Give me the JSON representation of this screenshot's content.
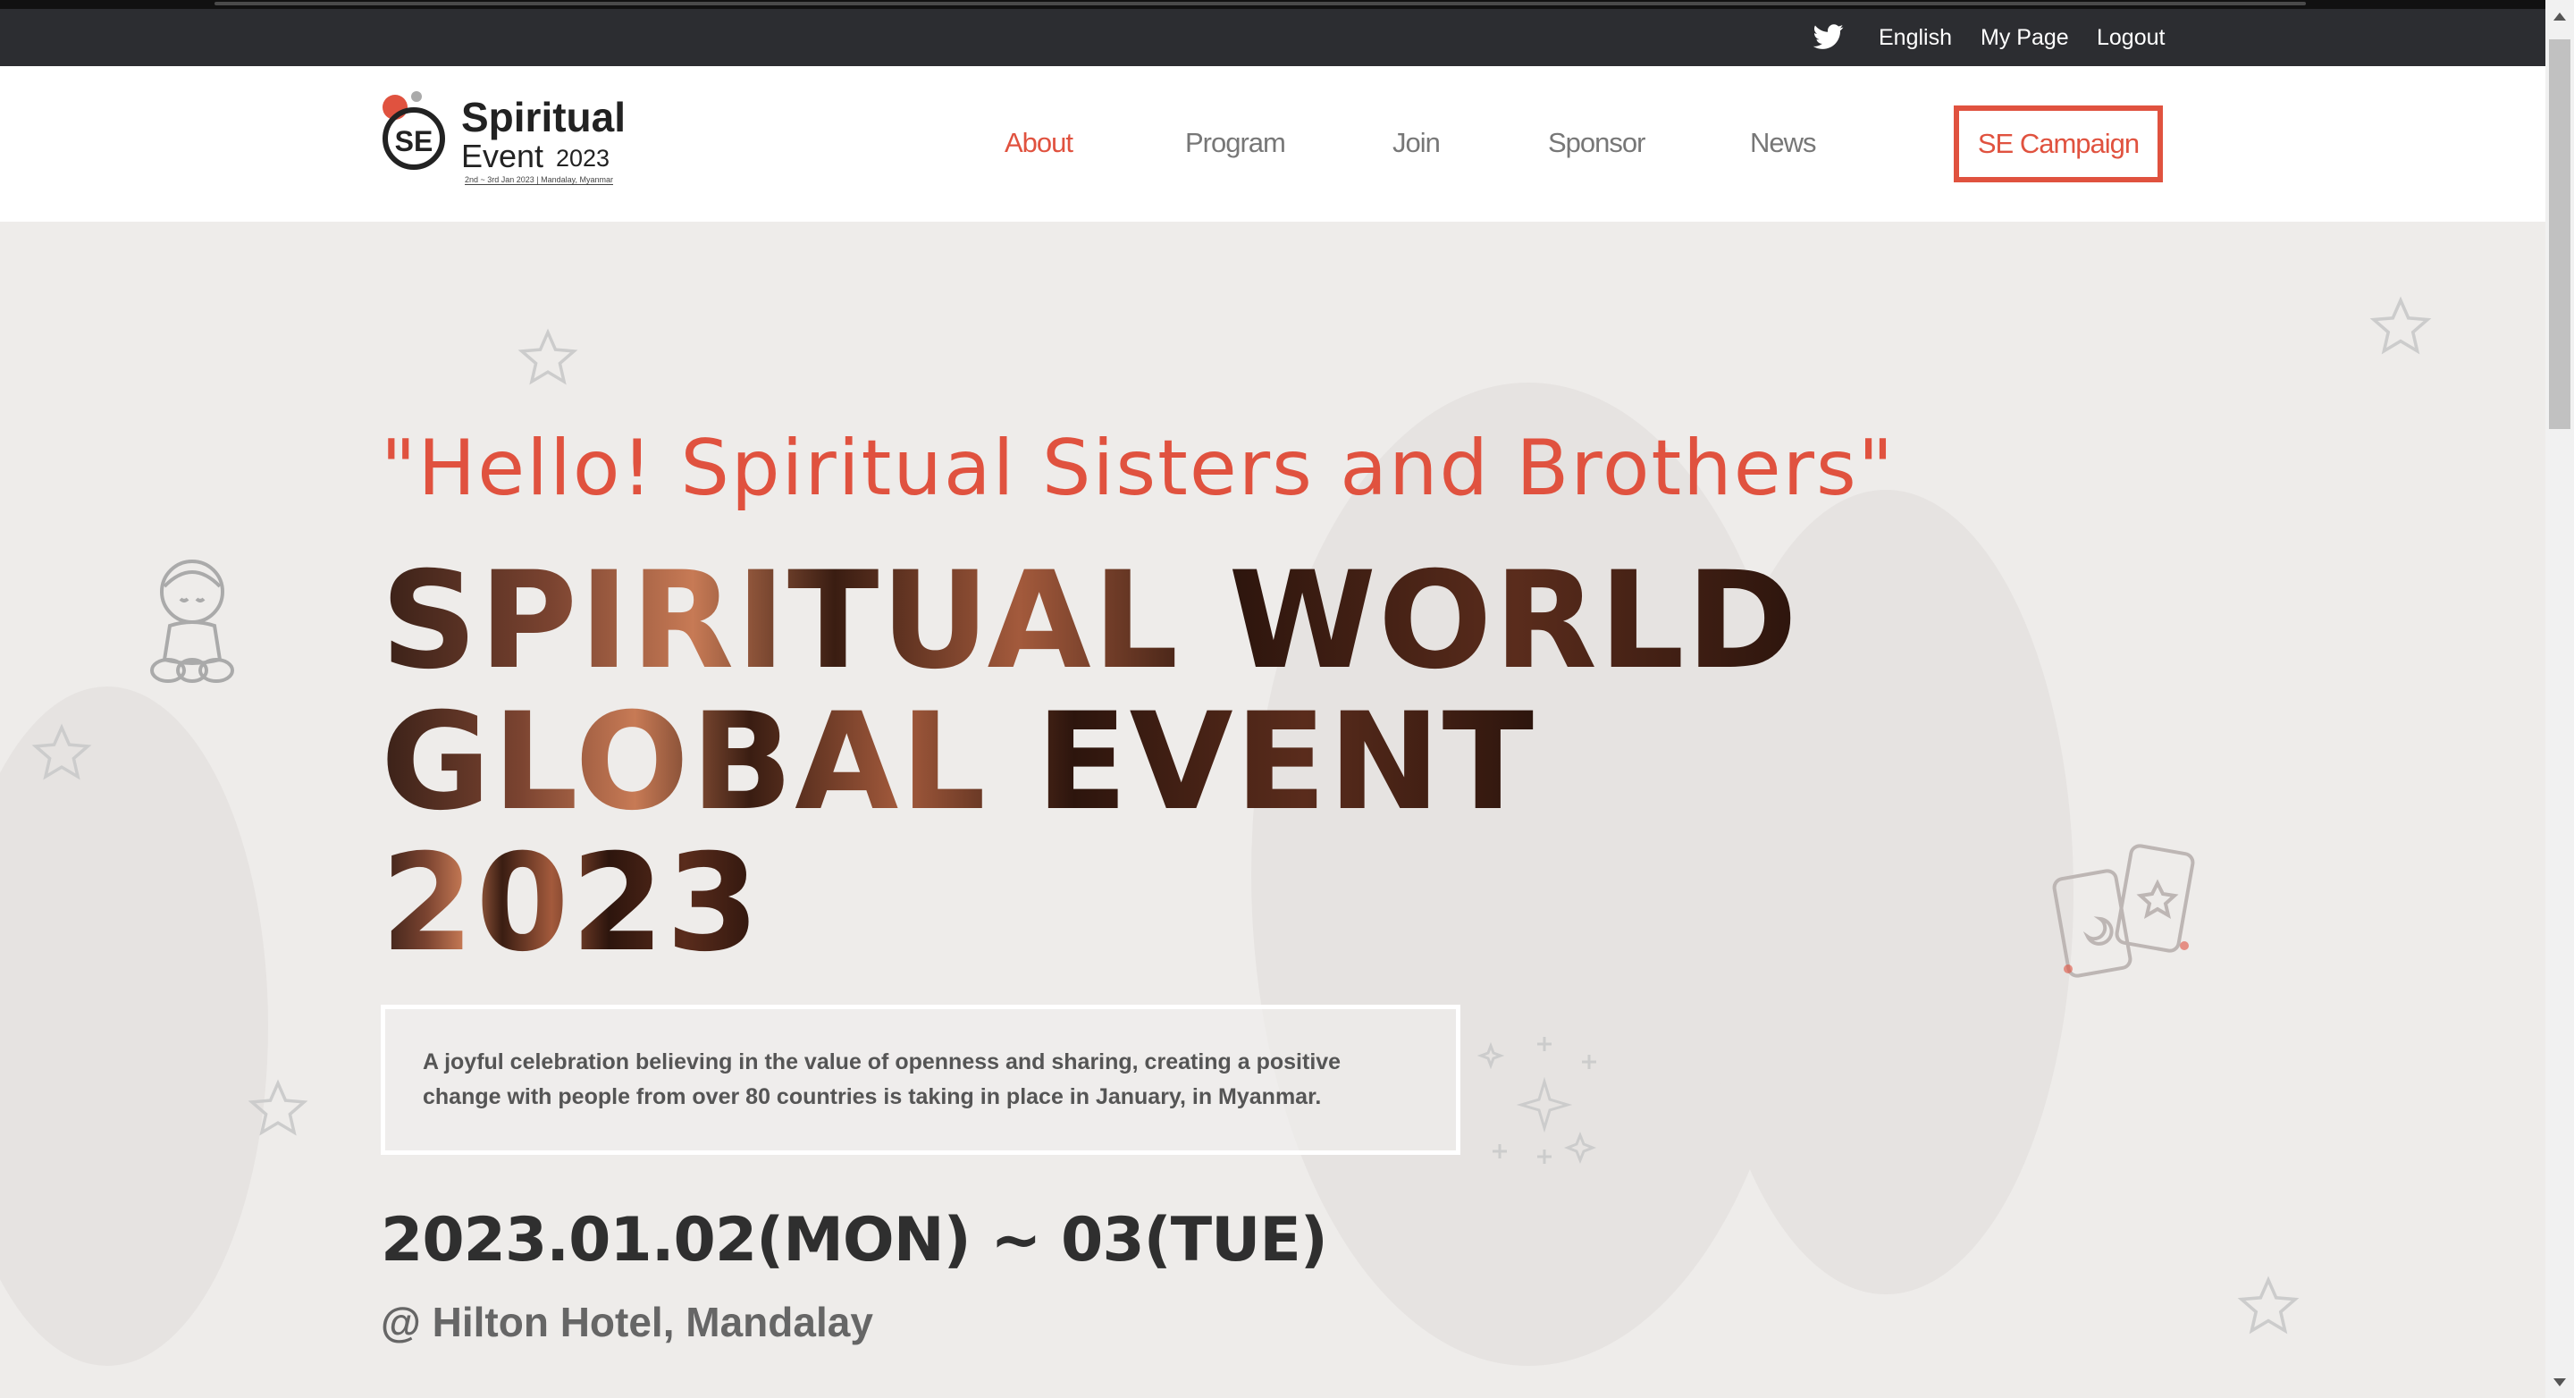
{
  "topbar": {
    "twitter_icon": "twitter-icon",
    "links": [
      "English",
      "My Page",
      "Logout"
    ]
  },
  "header": {
    "logo": {
      "badge": "SE",
      "title": "Spiritual",
      "subtitle": "Event",
      "year": "2023",
      "tagline": "2nd ~ 3rd Jan 2023 | Mandalay, Myanmar"
    },
    "nav": [
      {
        "label": "About",
        "active": true
      },
      {
        "label": "Program",
        "active": false
      },
      {
        "label": "Join",
        "active": false
      },
      {
        "label": "Sponsor",
        "active": false
      },
      {
        "label": "News",
        "active": false
      }
    ],
    "campaign_button": "SE Campaign"
  },
  "hero": {
    "greeting": "\"Hello! Spiritual Sisters and Brothers\"",
    "headline_lines": [
      "SPIRITUAL WORLD",
      "GLOBAL EVENT",
      "2023"
    ],
    "description": "A joyful celebration believing in the value of openness and sharing, creating a positive change with people from over 80 countries is taking in place in January, in Myanmar.",
    "date": "2023.01.02(MON) ~ 03(TUE)",
    "venue": "@ Hilton Hotel, Mandalay"
  },
  "colors": {
    "accent": "#e0523f",
    "topbar": "#2c2d31",
    "hero_bg": "#eeecea"
  }
}
